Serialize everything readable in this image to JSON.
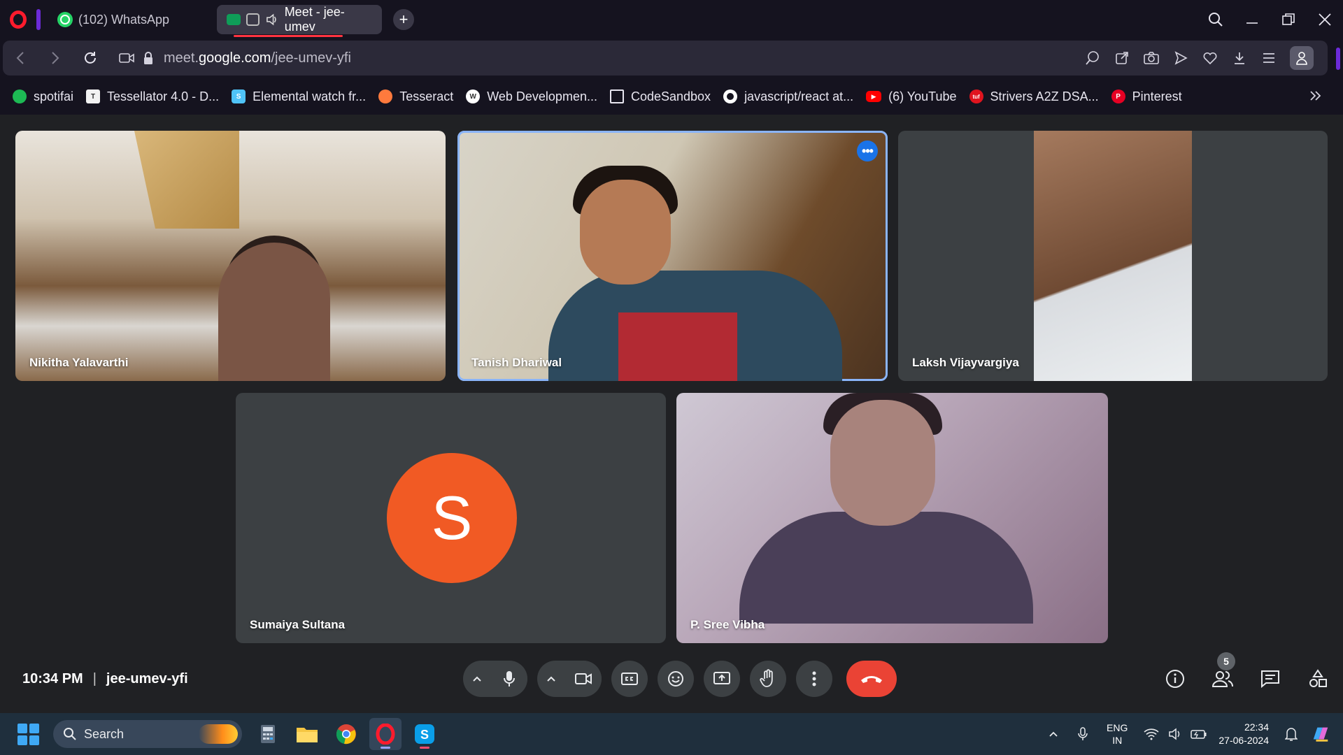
{
  "browser": {
    "tabs": [
      {
        "label": "(102) WhatsApp",
        "active": false
      },
      {
        "label": "Meet - jee-umev",
        "active": true
      }
    ],
    "url_prefix": "meet.",
    "url_domain": "google.com",
    "url_path": "/jee-umev-yfi",
    "accent_color": "#ff1b2d"
  },
  "bookmarks": [
    {
      "label": "spotifai",
      "icon": "spotify-icon",
      "color": "#1db954"
    },
    {
      "label": "Tessellator 4.0 - D...",
      "icon": "tessellator-icon",
      "color": "#ffffff"
    },
    {
      "label": "Elemental watch fr...",
      "icon": "elemental-icon",
      "color": "#4fc3f7"
    },
    {
      "label": "Tesseract",
      "icon": "tesseract-icon",
      "color": "#ff7a3d"
    },
    {
      "label": "Web Developmen...",
      "icon": "webdev-icon",
      "color": "#ffffff"
    },
    {
      "label": "CodeSandbox",
      "icon": "codesandbox-icon",
      "color": "#15131f"
    },
    {
      "label": "javascript/react at...",
      "icon": "github-icon",
      "color": "#ffffff"
    },
    {
      "label": "(6) YouTube",
      "icon": "youtube-icon",
      "color": "#ff0000"
    },
    {
      "label": "Strivers A2Z DSA...",
      "icon": "tuf-icon",
      "color": "#e0141e"
    },
    {
      "label": "Pinterest",
      "icon": "pinterest-icon",
      "color": "#e60023"
    }
  ],
  "participants": [
    {
      "name": "Nikitha Yalavarthi",
      "video": true
    },
    {
      "name": "Tanish Dhariwal",
      "video": true,
      "speaking": true
    },
    {
      "name": "Laksh Vijayvargiya",
      "video": true
    },
    {
      "name": "Sumaiya Sultana",
      "video": false,
      "initial": "S",
      "avatar_color": "#f15a24"
    },
    {
      "name": "P. Sree Vibha",
      "video": true
    }
  ],
  "meeting": {
    "time": "10:34 PM",
    "separator": "|",
    "code": "jee-umev-yfi",
    "participant_count": "5",
    "end_call_color": "#ea4335"
  },
  "taskbar": {
    "search_placeholder": "Search",
    "lang_line1": "ENG",
    "lang_line2": "IN",
    "time": "22:34",
    "date": "27-06-2024"
  }
}
